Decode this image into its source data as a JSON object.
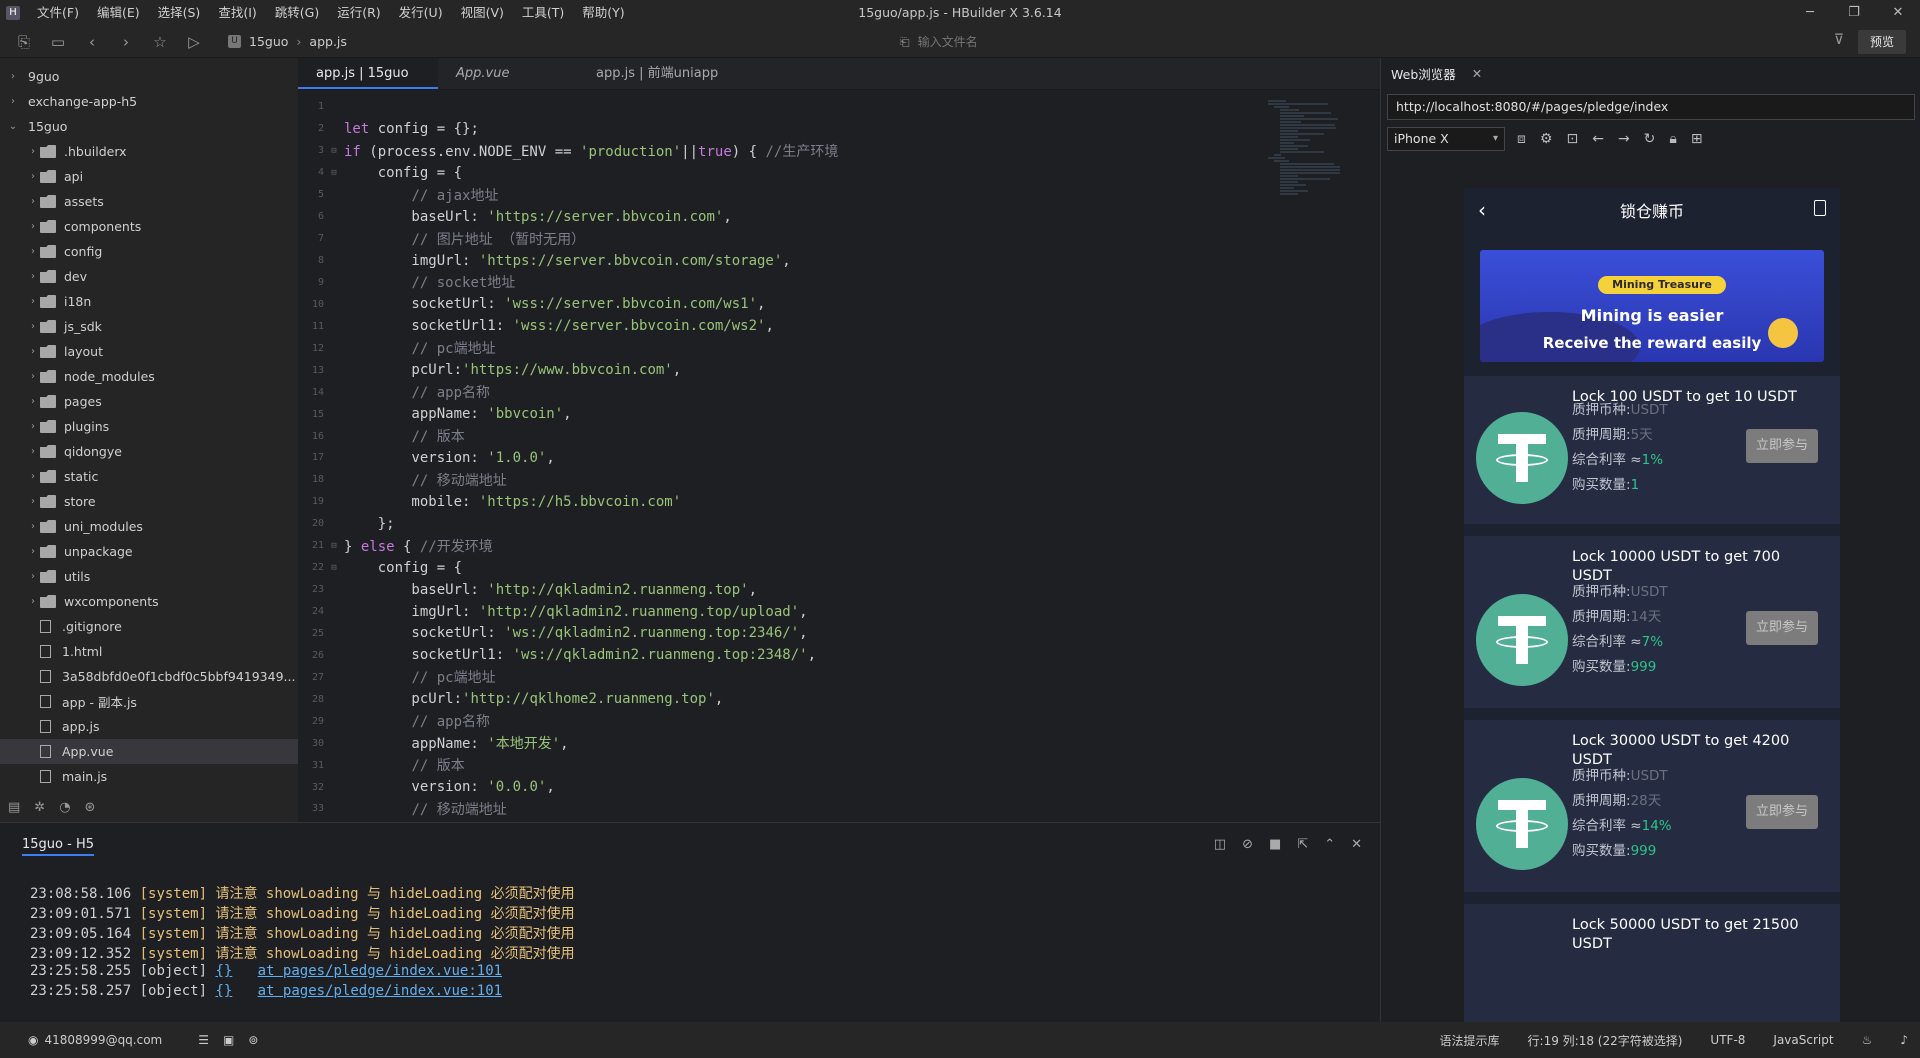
{
  "window": {
    "title": "15guo/app.js - HBuilder X 3.6.14",
    "menu": [
      "文件(F)",
      "编辑(E)",
      "选择(S)",
      "查找(I)",
      "跳转(G)",
      "运行(R)",
      "发行(U)",
      "视图(V)",
      "工具(T)",
      "帮助(Y)"
    ]
  },
  "toolbar": {
    "breadcrumb": [
      "15guo",
      "app.js"
    ],
    "file_input_placeholder": "输入文件名",
    "preview_label": "预览"
  },
  "sidebar": {
    "items": [
      {
        "label": "9guo",
        "type": "project",
        "expanded": false
      },
      {
        "label": "exchange-app-h5",
        "type": "project",
        "expanded": false
      },
      {
        "label": "15guo",
        "type": "project",
        "expanded": true
      },
      {
        "label": ".hbuilderx",
        "type": "folder"
      },
      {
        "label": "api",
        "type": "folder"
      },
      {
        "label": "assets",
        "type": "folder"
      },
      {
        "label": "components",
        "type": "folder"
      },
      {
        "label": "config",
        "type": "folder"
      },
      {
        "label": "dev",
        "type": "folder"
      },
      {
        "label": "i18n",
        "type": "folder"
      },
      {
        "label": "js_sdk",
        "type": "folder"
      },
      {
        "label": "layout",
        "type": "folder"
      },
      {
        "label": "node_modules",
        "type": "folder"
      },
      {
        "label": "pages",
        "type": "folder"
      },
      {
        "label": "plugins",
        "type": "folder"
      },
      {
        "label": "qidongye",
        "type": "folder"
      },
      {
        "label": "static",
        "type": "folder"
      },
      {
        "label": "store",
        "type": "folder"
      },
      {
        "label": "uni_modules",
        "type": "folder"
      },
      {
        "label": "unpackage",
        "type": "folder"
      },
      {
        "label": "utils",
        "type": "folder"
      },
      {
        "label": "wxcomponents",
        "type": "folder"
      },
      {
        "label": ".gitignore",
        "type": "file"
      },
      {
        "label": "1.html",
        "type": "file"
      },
      {
        "label": "3a58dbfd0e0f1cbdf0c5bbf9419349...",
        "type": "file"
      },
      {
        "label": "app - 副本.js",
        "type": "file"
      },
      {
        "label": "app.js",
        "type": "file"
      },
      {
        "label": "App.vue",
        "type": "file",
        "active": true
      },
      {
        "label": "main.js",
        "type": "file"
      }
    ]
  },
  "editor": {
    "tabs": [
      {
        "label": "app.js | 15guo",
        "active": true
      },
      {
        "label": "App.vue",
        "italic": true
      },
      {
        "label": "app.js | 前端uniapp"
      }
    ],
    "lines": [
      "",
      "let config = {};",
      "if (process.env.NODE_ENV == 'production'||true) { //生产环境",
      "    config = {",
      "        // ajax地址",
      "        baseUrl: 'https://server.bbvcoin.com',",
      "        // 图片地址 （暂时无用）",
      "        imgUrl: 'https://server.bbvcoin.com/storage',",
      "        // socket地址",
      "        socketUrl: 'wss://server.bbvcoin.com/ws1',",
      "        socketUrl1: 'wss://server.bbvcoin.com/ws2',",
      "        // pc端地址",
      "        pcUrl:'https://www.bbvcoin.com',",
      "        // app名称",
      "        appName: 'bbvcoin',",
      "        // 版本",
      "        version: '1.0.0',",
      "        // 移动端地址",
      "        mobile: 'https://h5.bbvcoin.com'",
      "    };",
      "} else { //开发环境",
      "    config = {",
      "        baseUrl: 'http://qkladmin2.ruanmeng.top',",
      "        imgUrl: 'http://qkladmin2.ruanmeng.top/upload',",
      "        socketUrl: 'ws://qkladmin2.ruanmeng.top:2346/',",
      "        socketUrl1: 'ws://qkladmin2.ruanmeng.top:2348/',",
      "        // pc端地址",
      "        pcUrl:'http://qklhome2.ruanmeng.top',",
      "        // app名称",
      "        appName: '本地开发',",
      "        // 版本",
      "        version: '0.0.0',",
      "        // 移动端地址"
    ]
  },
  "console": {
    "title": "15guo - H5",
    "lines": [
      {
        "time": "23:08:58.106",
        "tag": "[system]",
        "msg": "请注意 showLoading 与 hideLoading 必须配对使用"
      },
      {
        "time": "23:09:01.571",
        "tag": "[system]",
        "msg": "请注意 showLoading 与 hideLoading 必须配对使用"
      },
      {
        "time": "23:09:05.164",
        "tag": "[system]",
        "msg": "请注意 showLoading 与 hideLoading 必须配对使用"
      },
      {
        "time": "23:09:12.352",
        "tag": "[system]",
        "msg": "请注意 showLoading 与 hideLoading 必须配对使用"
      },
      {
        "time": "23:25:58.255",
        "tag": "[object]",
        "obj": "{}",
        "link": "at pages/pledge/index.vue:101"
      },
      {
        "time": "23:25:58.257",
        "tag": "[object]",
        "obj": "{}",
        "link": "at pages/pledge/index.vue:101"
      }
    ]
  },
  "statusbar": {
    "user": "41808999@qq.com",
    "hint": "语法提示库",
    "position": "行:19  列:18 (22字符被选择)",
    "encoding": "UTF-8",
    "language": "JavaScript"
  },
  "browser": {
    "tab_label": "Web浏览器",
    "url": "http://localhost:8080/#/pages/pledge/index",
    "device": "iPhone X",
    "page_title": "锁仓赚币",
    "banner": {
      "pill": "Mining Treasure",
      "line1": "Mining is easier",
      "line2": "Receive the reward easily"
    },
    "labels": {
      "coin": "质押币种:",
      "period": "质押周期:",
      "rate": "综合利率 ≈",
      "qty": "购买数量:",
      "join": "立即参与"
    },
    "cards": [
      {
        "title": "Lock 100 USDT to get 10 USDT",
        "coin": "USDT",
        "period": "5天",
        "rate": "1%",
        "qty": "1"
      },
      {
        "title": "Lock 10000 USDT to get 700 USDT",
        "coin": "USDT",
        "period": "14天",
        "rate": "7%",
        "qty": "999"
      },
      {
        "title": "Lock 30000 USDT to get 4200 USDT",
        "coin": "USDT",
        "period": "28天",
        "rate": "14%",
        "qty": "999"
      },
      {
        "title": "Lock 50000 USDT to get 21500 USDT"
      }
    ]
  }
}
